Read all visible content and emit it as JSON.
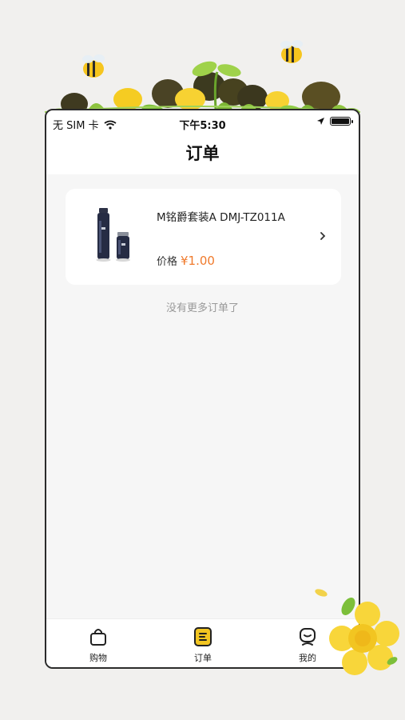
{
  "status_bar": {
    "carrier": "无 SIM 卡",
    "time": "下午5:30"
  },
  "nav": {
    "title": "订单"
  },
  "orders": [
    {
      "title": "M铭爵套装A DMJ-TZ011A",
      "price_label": "价格",
      "price": "¥1.00",
      "thumbnail_icon": "thermos-set-image"
    }
  ],
  "list_footer": "没有更多订单了",
  "tabbar": {
    "items": [
      {
        "label": "购物",
        "icon": "shopping-bag-icon",
        "active": false
      },
      {
        "label": "订单",
        "icon": "order-list-icon",
        "active": true
      },
      {
        "label": "我的",
        "icon": "profile-icon",
        "active": false
      }
    ]
  },
  "colors": {
    "price": "#f07a2c",
    "active_tab": "#f2c521",
    "background": "#f6f6f6"
  }
}
